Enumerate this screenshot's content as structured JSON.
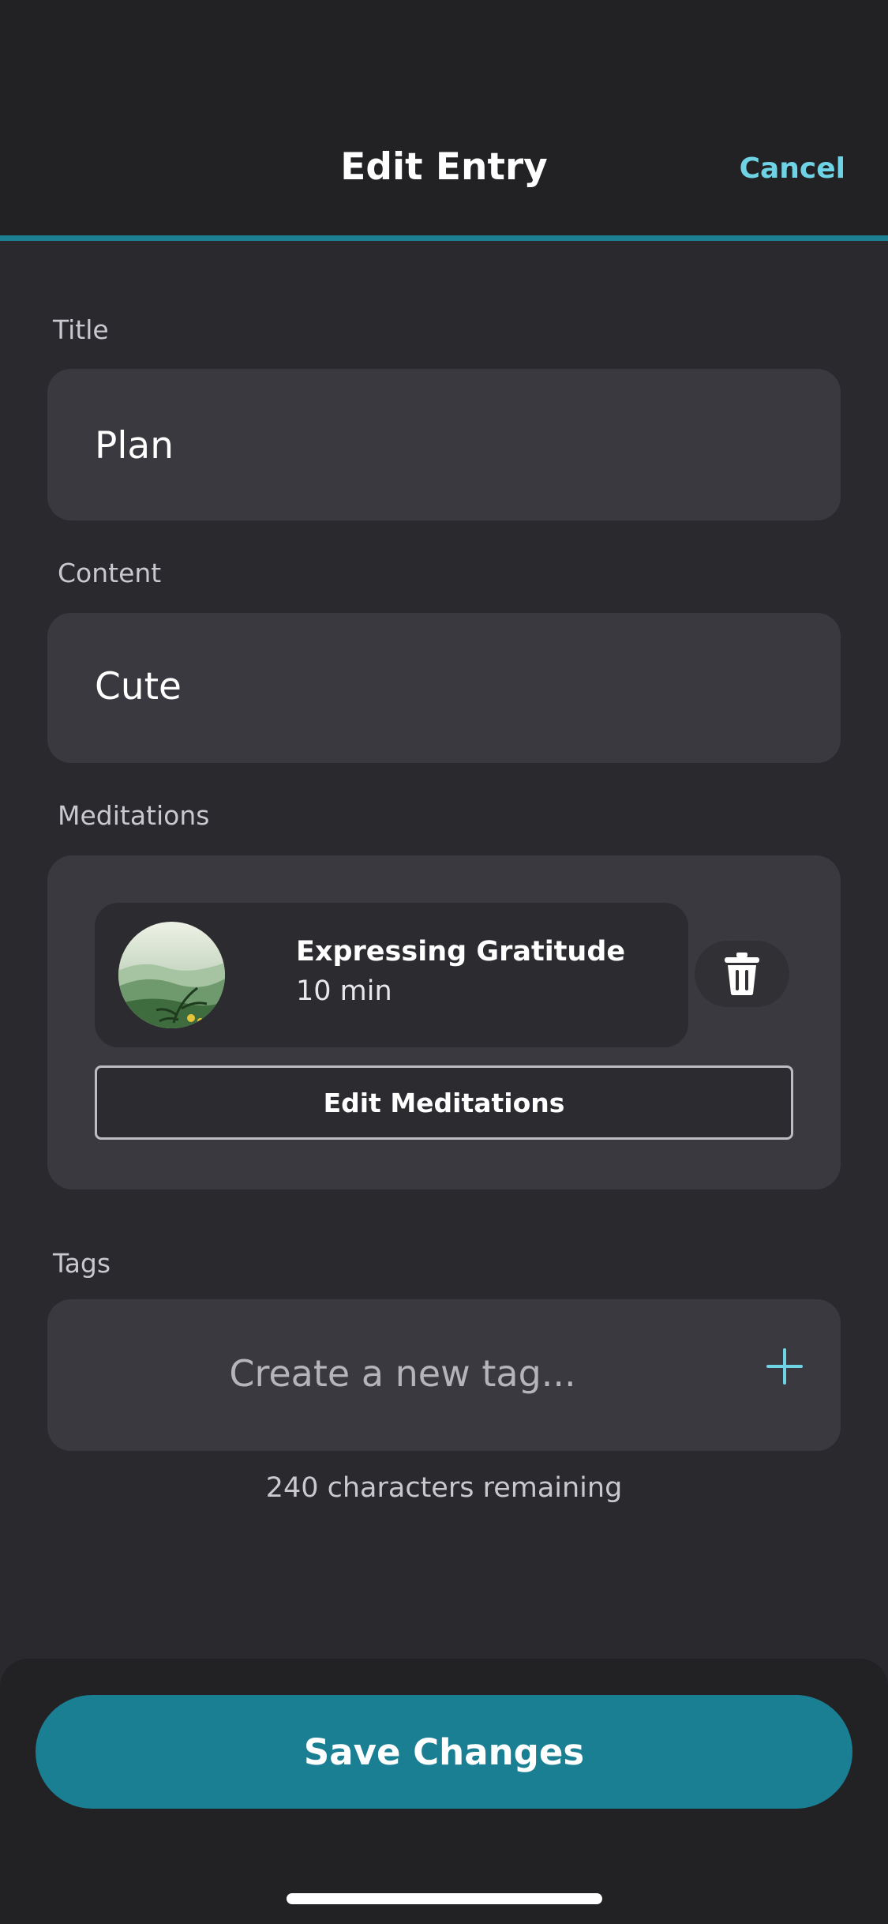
{
  "header": {
    "title": "Edit Entry",
    "cancel_label": "Cancel"
  },
  "form": {
    "title_label": "Title",
    "title_value": "Plan",
    "content_label": "Content",
    "content_value": "Cute",
    "meditations_label": "Meditations",
    "tags_label": "Tags",
    "tag_placeholder": "Create a new tag...",
    "chars_remaining": "240 characters remaining"
  },
  "meditations": {
    "items": [
      {
        "title": "Expressing Gratitude",
        "duration": "10 min",
        "thumbnail": "landscape-thumbnail"
      }
    ],
    "edit_label": "Edit Meditations"
  },
  "footer": {
    "save_label": "Save Changes"
  },
  "colors": {
    "accent": "#1a7f93",
    "link": "#6fd3e6",
    "background": "#2a292e",
    "field": "#3a393f"
  },
  "icons": {
    "delete": "trash-icon",
    "add_tag": "plus-icon"
  }
}
